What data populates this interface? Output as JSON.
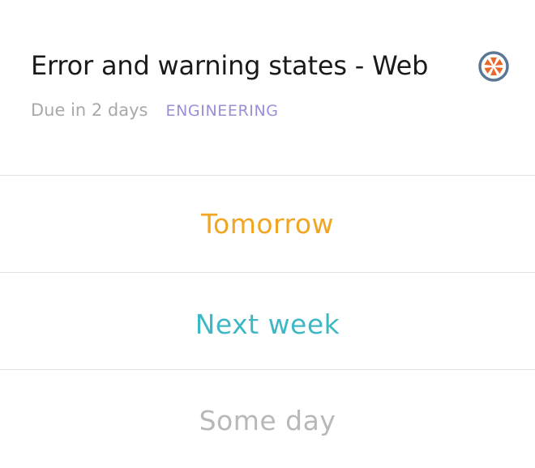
{
  "task": {
    "title": "Error and warning states - Web",
    "due": "Due in 2 days",
    "tag": "ENGINEERING",
    "app_icon": "pinwheel-icon"
  },
  "snooze_options": [
    {
      "label": "Tomorrow",
      "color": "#f0a623"
    },
    {
      "label": "Next week",
      "color": "#3eb8c4"
    },
    {
      "label": "Some day",
      "color": "#b8b8b8"
    }
  ],
  "colors": {
    "title": "#1a1a1a",
    "muted": "#a9a9a9",
    "tag": "#9b8fd6",
    "icon_ring": "#5a7896",
    "icon_accent": "#e8692a",
    "divider": "#e1e1e1"
  }
}
